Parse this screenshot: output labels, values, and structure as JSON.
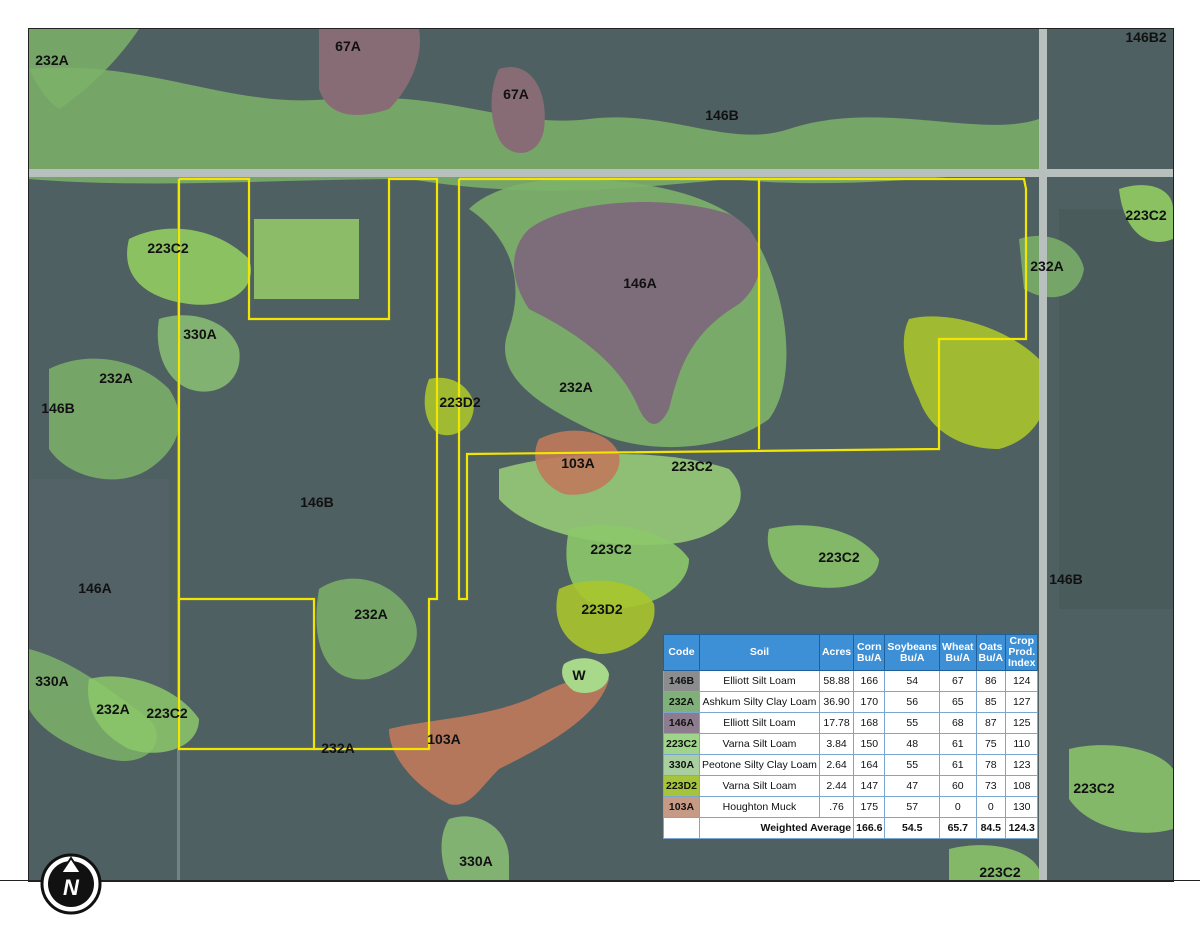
{
  "map": {
    "soil_labels": [
      "232A",
      "67A",
      "67A",
      "146B",
      "146B2",
      "223C2",
      "223C2",
      "232A",
      "330A",
      "232A",
      "146B",
      "146A",
      "223D2",
      "232A",
      "146A",
      "103A",
      "223C2",
      "146B",
      "223C2",
      "223D2",
      "223C2",
      "146B",
      "232A",
      "W",
      "330A",
      "232A",
      "223C2",
      "232A",
      "103A",
      "223C2",
      "330A",
      "223C2"
    ],
    "boundary_color": "#f2e600",
    "soil_colors": {
      "232A": "#7fb56a",
      "146A": "#7d6e7c",
      "146B": "#4f6064",
      "223C2": "#8fcc5c",
      "223D2": "#a8cc2a",
      "330A": "#7fb56a",
      "67A": "#8c6a6a",
      "103A": "#c07a5c"
    }
  },
  "legend": {
    "headers": [
      "Code",
      "Soil",
      "Acres",
      "Corn Bu/A",
      "Soybeans Bu/A",
      "Wheat Bu/A",
      "Oats Bu/A",
      "Crop Prod. Index"
    ],
    "rows": [
      {
        "code": "146B",
        "soil": "Elliott Silt Loam",
        "acres": "58.88",
        "corn": "166",
        "soy": "54",
        "wheat": "67",
        "oats": "86",
        "cpi": "124",
        "color": "#8a8c8e"
      },
      {
        "code": "232A",
        "soil": "Ashkum Silty Clay Loam",
        "acres": "36.90",
        "corn": "170",
        "soy": "56",
        "wheat": "65",
        "oats": "85",
        "cpi": "127",
        "color": "#7fb07a"
      },
      {
        "code": "146A",
        "soil": "Elliott Silt Loam",
        "acres": "17.78",
        "corn": "168",
        "soy": "55",
        "wheat": "68",
        "oats": "87",
        "cpi": "125",
        "color": "#8d7c8d"
      },
      {
        "code": "223C2",
        "soil": "Varna Silt Loam",
        "acres": "3.84",
        "corn": "150",
        "soy": "48",
        "wheat": "61",
        "oats": "75",
        "cpi": "110",
        "color": "#9fd58a"
      },
      {
        "code": "330A",
        "soil": "Peotone Silty Clay Loam",
        "acres": "2.64",
        "corn": "164",
        "soy": "55",
        "wheat": "61",
        "oats": "78",
        "cpi": "123",
        "color": "#a9cfa0"
      },
      {
        "code": "223D2",
        "soil": "Varna Silt Loam",
        "acres": "2.44",
        "corn": "147",
        "soy": "47",
        "wheat": "60",
        "oats": "73",
        "cpi": "108",
        "color": "#a6c43a"
      },
      {
        "code": "103A",
        "soil": "Houghton Muck",
        "acres": ".76",
        "corn": "175",
        "soy": "57",
        "wheat": "0",
        "oats": "0",
        "cpi": "130",
        "color": "#c79a86"
      }
    ],
    "average": {
      "label": "Weighted Average",
      "corn": "166.6",
      "soy": "54.5",
      "wheat": "65.7",
      "oats": "84.5",
      "cpi": "124.3"
    }
  },
  "compass": {
    "letter": "N"
  }
}
